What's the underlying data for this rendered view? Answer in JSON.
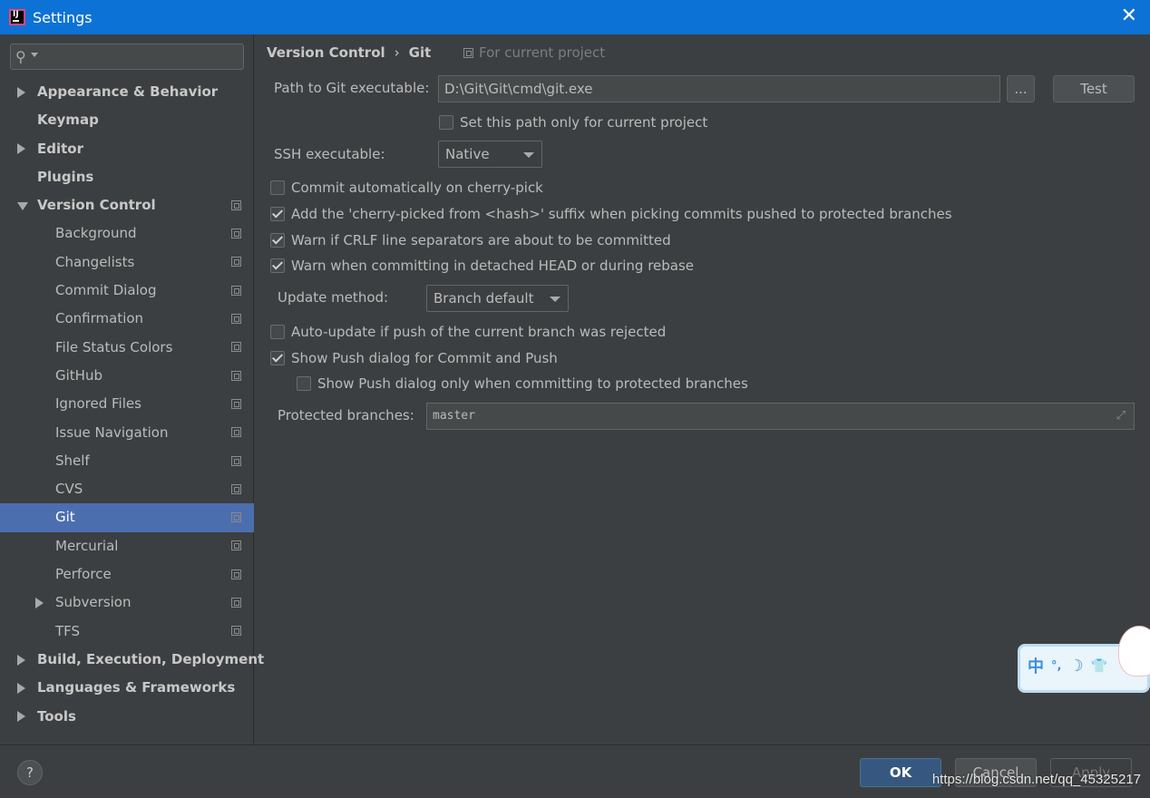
{
  "window": {
    "title": "Settings"
  },
  "search": {
    "placeholder": ""
  },
  "sidebar": {
    "items": [
      {
        "label": "Appearance & Behavior",
        "level": "top",
        "arrow": "right",
        "proj": false
      },
      {
        "label": "Keymap",
        "level": "top",
        "arrow": "",
        "proj": false
      },
      {
        "label": "Editor",
        "level": "top",
        "arrow": "right",
        "proj": false
      },
      {
        "label": "Plugins",
        "level": "top",
        "arrow": "",
        "proj": false
      },
      {
        "label": "Version Control",
        "level": "top",
        "arrow": "down",
        "proj": true
      },
      {
        "label": "Background",
        "level": "sub",
        "arrow": "",
        "proj": true
      },
      {
        "label": "Changelists",
        "level": "sub",
        "arrow": "",
        "proj": true
      },
      {
        "label": "Commit Dialog",
        "level": "sub",
        "arrow": "",
        "proj": true
      },
      {
        "label": "Confirmation",
        "level": "sub",
        "arrow": "",
        "proj": true
      },
      {
        "label": "File Status Colors",
        "level": "sub",
        "arrow": "",
        "proj": true
      },
      {
        "label": "GitHub",
        "level": "sub",
        "arrow": "",
        "proj": true
      },
      {
        "label": "Ignored Files",
        "level": "sub",
        "arrow": "",
        "proj": true
      },
      {
        "label": "Issue Navigation",
        "level": "sub",
        "arrow": "",
        "proj": true
      },
      {
        "label": "Shelf",
        "level": "sub",
        "arrow": "",
        "proj": true
      },
      {
        "label": "CVS",
        "level": "sub",
        "arrow": "",
        "proj": true
      },
      {
        "label": "Git",
        "level": "sub",
        "arrow": "",
        "proj": true,
        "selected": true
      },
      {
        "label": "Mercurial",
        "level": "sub",
        "arrow": "",
        "proj": true
      },
      {
        "label": "Perforce",
        "level": "sub",
        "arrow": "",
        "proj": true
      },
      {
        "label": "Subversion",
        "level": "sub",
        "arrow": "right",
        "proj": true
      },
      {
        "label": "TFS",
        "level": "sub",
        "arrow": "",
        "proj": true
      },
      {
        "label": "Build, Execution, Deployment",
        "level": "top",
        "arrow": "right",
        "proj": false
      },
      {
        "label": "Languages & Frameworks",
        "level": "top",
        "arrow": "right",
        "proj": false
      },
      {
        "label": "Tools",
        "level": "top",
        "arrow": "right",
        "proj": false
      }
    ]
  },
  "breadcrumb": {
    "parent": "Version Control",
    "separator": "›",
    "current": "Git",
    "scope": "For current project"
  },
  "git": {
    "path_label": "Path to Git executable:",
    "path_value": "D:\\Git\\Git\\cmd\\git.exe",
    "browse_label": "...",
    "test_label": "Test",
    "set_path_only": {
      "label": "Set this path only for current project",
      "checked": false
    },
    "ssh_label": "SSH executable:",
    "ssh_value": "Native",
    "commit_auto": {
      "label": "Commit automatically on cherry-pick",
      "checked": false
    },
    "cherry_suffix": {
      "label": "Add the 'cherry-picked from <hash>' suffix when picking commits pushed to protected branches",
      "checked": true
    },
    "warn_crlf": {
      "label": "Warn if CRLF line separators are about to be committed",
      "checked": true
    },
    "warn_detached": {
      "label": "Warn when committing in detached HEAD or during rebase",
      "checked": true
    },
    "update_label": "Update method:",
    "update_value": "Branch default",
    "auto_update": {
      "label": "Auto-update if push of the current branch was rejected",
      "checked": false
    },
    "show_push": {
      "label": "Show Push dialog for Commit and Push",
      "checked": true
    },
    "show_push_protected": {
      "label": "Show Push dialog only when committing to protected branches",
      "checked": false
    },
    "protected_label": "Protected branches:",
    "protected_value": "master"
  },
  "footer": {
    "help_label": "?",
    "ok_label": "OK",
    "cancel_label": "Cancel",
    "apply_label": "Apply",
    "watermark": "https://blog.csdn.net/qq_45325217"
  },
  "ime": {
    "char": "中",
    "punct": "°,",
    "moon": "☽",
    "shirt": "👕"
  },
  "colors": {
    "titlebar": "#0d72d6",
    "background": "#3c3f41",
    "selection": "#4b6eaf",
    "ok_button": "#365880"
  }
}
